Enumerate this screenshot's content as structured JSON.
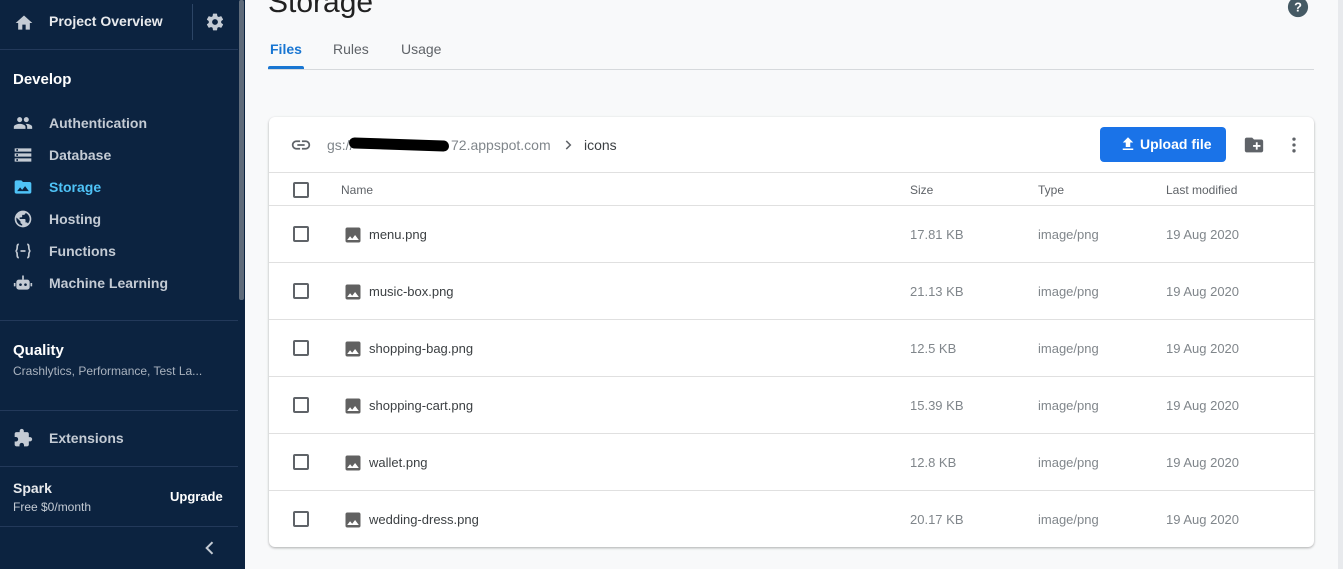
{
  "sidebar": {
    "project_title": "Project Overview",
    "develop_title": "Develop",
    "develop_items": [
      {
        "label": "Authentication",
        "icon": "people-icon"
      },
      {
        "label": "Database",
        "icon": "database-icon"
      },
      {
        "label": "Storage",
        "icon": "storage-icon"
      },
      {
        "label": "Hosting",
        "icon": "globe-icon"
      },
      {
        "label": "Functions",
        "icon": "functions-icon"
      },
      {
        "label": "Machine Learning",
        "icon": "robot-icon"
      }
    ],
    "quality_title": "Quality",
    "quality_sub": "Crashlytics, Performance, Test La...",
    "extensions_label": "Extensions",
    "plan_name": "Spark",
    "plan_price": "Free $0/month",
    "upgrade_label": "Upgrade"
  },
  "header": {
    "title": "Storage",
    "tabs": [
      {
        "label": "Files",
        "active": true
      },
      {
        "label": "Rules",
        "active": false
      },
      {
        "label": "Usage",
        "active": false
      }
    ]
  },
  "path": {
    "prefix": "gs://",
    "bucket_suffix": "72.appspot.com",
    "folder": "icons"
  },
  "toolbar": {
    "upload_label": "Upload file"
  },
  "table": {
    "columns": [
      "Name",
      "Size",
      "Type",
      "Last modified"
    ],
    "rows": [
      {
        "name": "menu.png",
        "size": "17.81 KB",
        "type": "image/png",
        "modified": "19 Aug 2020"
      },
      {
        "name": "music-box.png",
        "size": "21.13 KB",
        "type": "image/png",
        "modified": "19 Aug 2020"
      },
      {
        "name": "shopping-bag.png",
        "size": "12.5 KB",
        "type": "image/png",
        "modified": "19 Aug 2020"
      },
      {
        "name": "shopping-cart.png",
        "size": "15.39 KB",
        "type": "image/png",
        "modified": "19 Aug 2020"
      },
      {
        "name": "wallet.png",
        "size": "12.8 KB",
        "type": "image/png",
        "modified": "19 Aug 2020"
      },
      {
        "name": "wedding-dress.png",
        "size": "20.17 KB",
        "type": "image/png",
        "modified": "19 Aug 2020"
      }
    ]
  },
  "colors": {
    "sidebar_bg": "#0c2340",
    "accent": "#1a73e8",
    "active_nav": "#4fc3f7"
  }
}
